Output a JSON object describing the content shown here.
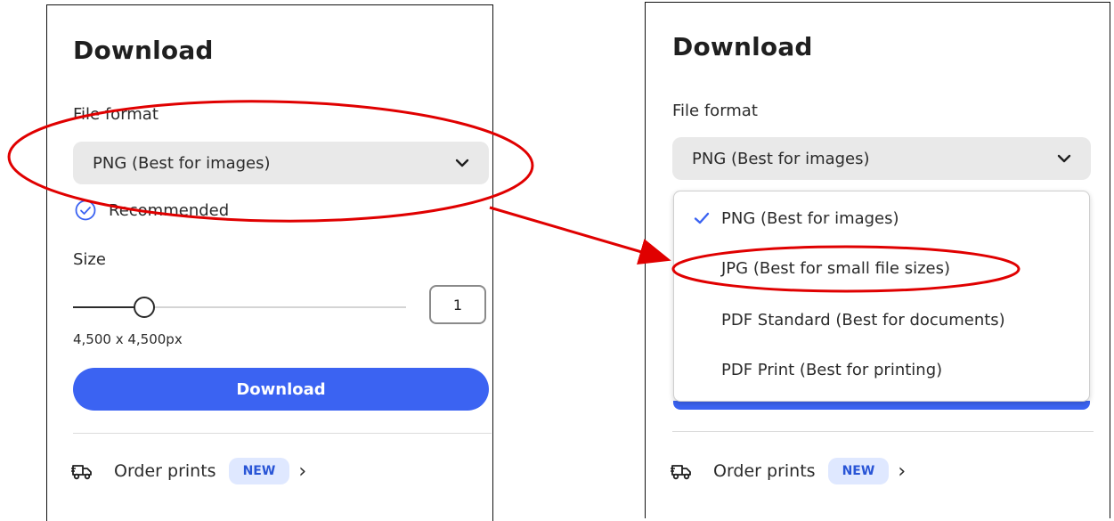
{
  "left": {
    "title": "Download",
    "file_format_label": "File format",
    "format_selected": "PNG (Best for images)",
    "recommended_label": "Recommended",
    "size_label": "Size",
    "size_value": "1",
    "size_slider_level": 0.24,
    "dimensions": "4,500 x 4,500px",
    "download_button": "Download",
    "order_prints": "Order prints",
    "new_badge": "NEW"
  },
  "right": {
    "title": "Download",
    "file_format_label": "File format",
    "format_selected": "PNG (Best for images)",
    "menu_items": [
      {
        "label": "PNG (Best for images)",
        "checked": true
      },
      {
        "label": "JPG (Best for small file sizes)",
        "checked": false
      },
      {
        "label": "PDF Standard (Best for documents)",
        "checked": false
      },
      {
        "label": "PDF Print (Best for printing)",
        "checked": false
      }
    ],
    "order_prints": "Order prints",
    "new_badge": "NEW"
  },
  "colors": {
    "accent": "#3b63f2",
    "annotation": "#e00000",
    "badge_bg": "#dfe8ff",
    "badge_text": "#2955d6"
  },
  "icons": [
    "chevron-down-icon",
    "check-circle-icon",
    "truck-icon",
    "chevron-right-icon",
    "checkmark-icon"
  ]
}
